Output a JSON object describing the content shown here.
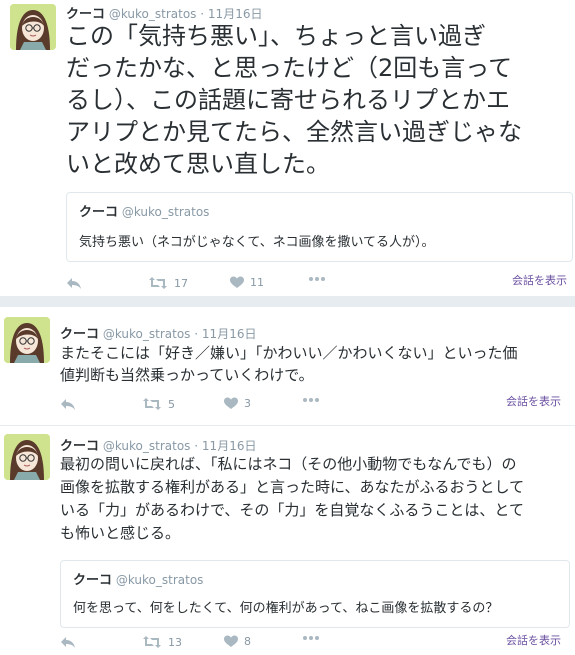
{
  "tweets": [
    {
      "name": "クーコ",
      "handle": "@kuko_stratos",
      "dot": "·",
      "date": "11月16日",
      "text_lines": [
        "この「気持ち悪い」、ちょっと言い過ぎ",
        "だったかな、と思ったけど（2回も言って",
        "るし）、この話題に寄せられるリプとかエ",
        "アリプとか見てたら、全然言い過ぎじゃな",
        "いと改めて思い直した。"
      ],
      "quote": {
        "name": "クーコ",
        "handle": "@kuko_stratos",
        "text": "気持ち悪い（ネコがじゃなくて、ネコ画像を撒いてる人が）。"
      },
      "retweets": "17",
      "likes": "11",
      "conversation_label": "会話を表示"
    },
    {
      "name": "クーコ",
      "handle": "@kuko_stratos",
      "dot": "·",
      "date": "11月16日",
      "text_lines": [
        "またそこには「好き／嫌い」「かわいい／かわいくない」といった価",
        "値判断も当然乗っかっていくわけで。"
      ],
      "retweets": "5",
      "likes": "3",
      "conversation_label": "会話を表示"
    },
    {
      "name": "クーコ",
      "handle": "@kuko_stratos",
      "dot": "·",
      "date": "11月16日",
      "text_lines": [
        "最初の問いに戻れば、「私にはネコ（その他小動物でもなんでも）の",
        "画像を拡散する権利がある」と言った時に、あなたがふるおうとして",
        "いる「力」があるわけで、その「力」を自覚なくふるうことは、とて",
        "も怖いと感じる。"
      ],
      "quote": {
        "name": "クーコ",
        "handle": "@kuko_stratos",
        "text": "何を思って、何をしたくて、何の権利があって、ねこ画像を拡散するの？"
      },
      "retweets": "13",
      "likes": "8",
      "conversation_label": "会話を表示"
    }
  ],
  "icons": {
    "reply": "reply-icon",
    "retweet": "retweet-icon",
    "like": "heart-icon",
    "more": "more-icon"
  },
  "colors": {
    "text": "#292f33",
    "muted": "#8899a6",
    "action": "#aab8c2",
    "link": "#6a4fa0",
    "border": "#e1e8ed"
  }
}
